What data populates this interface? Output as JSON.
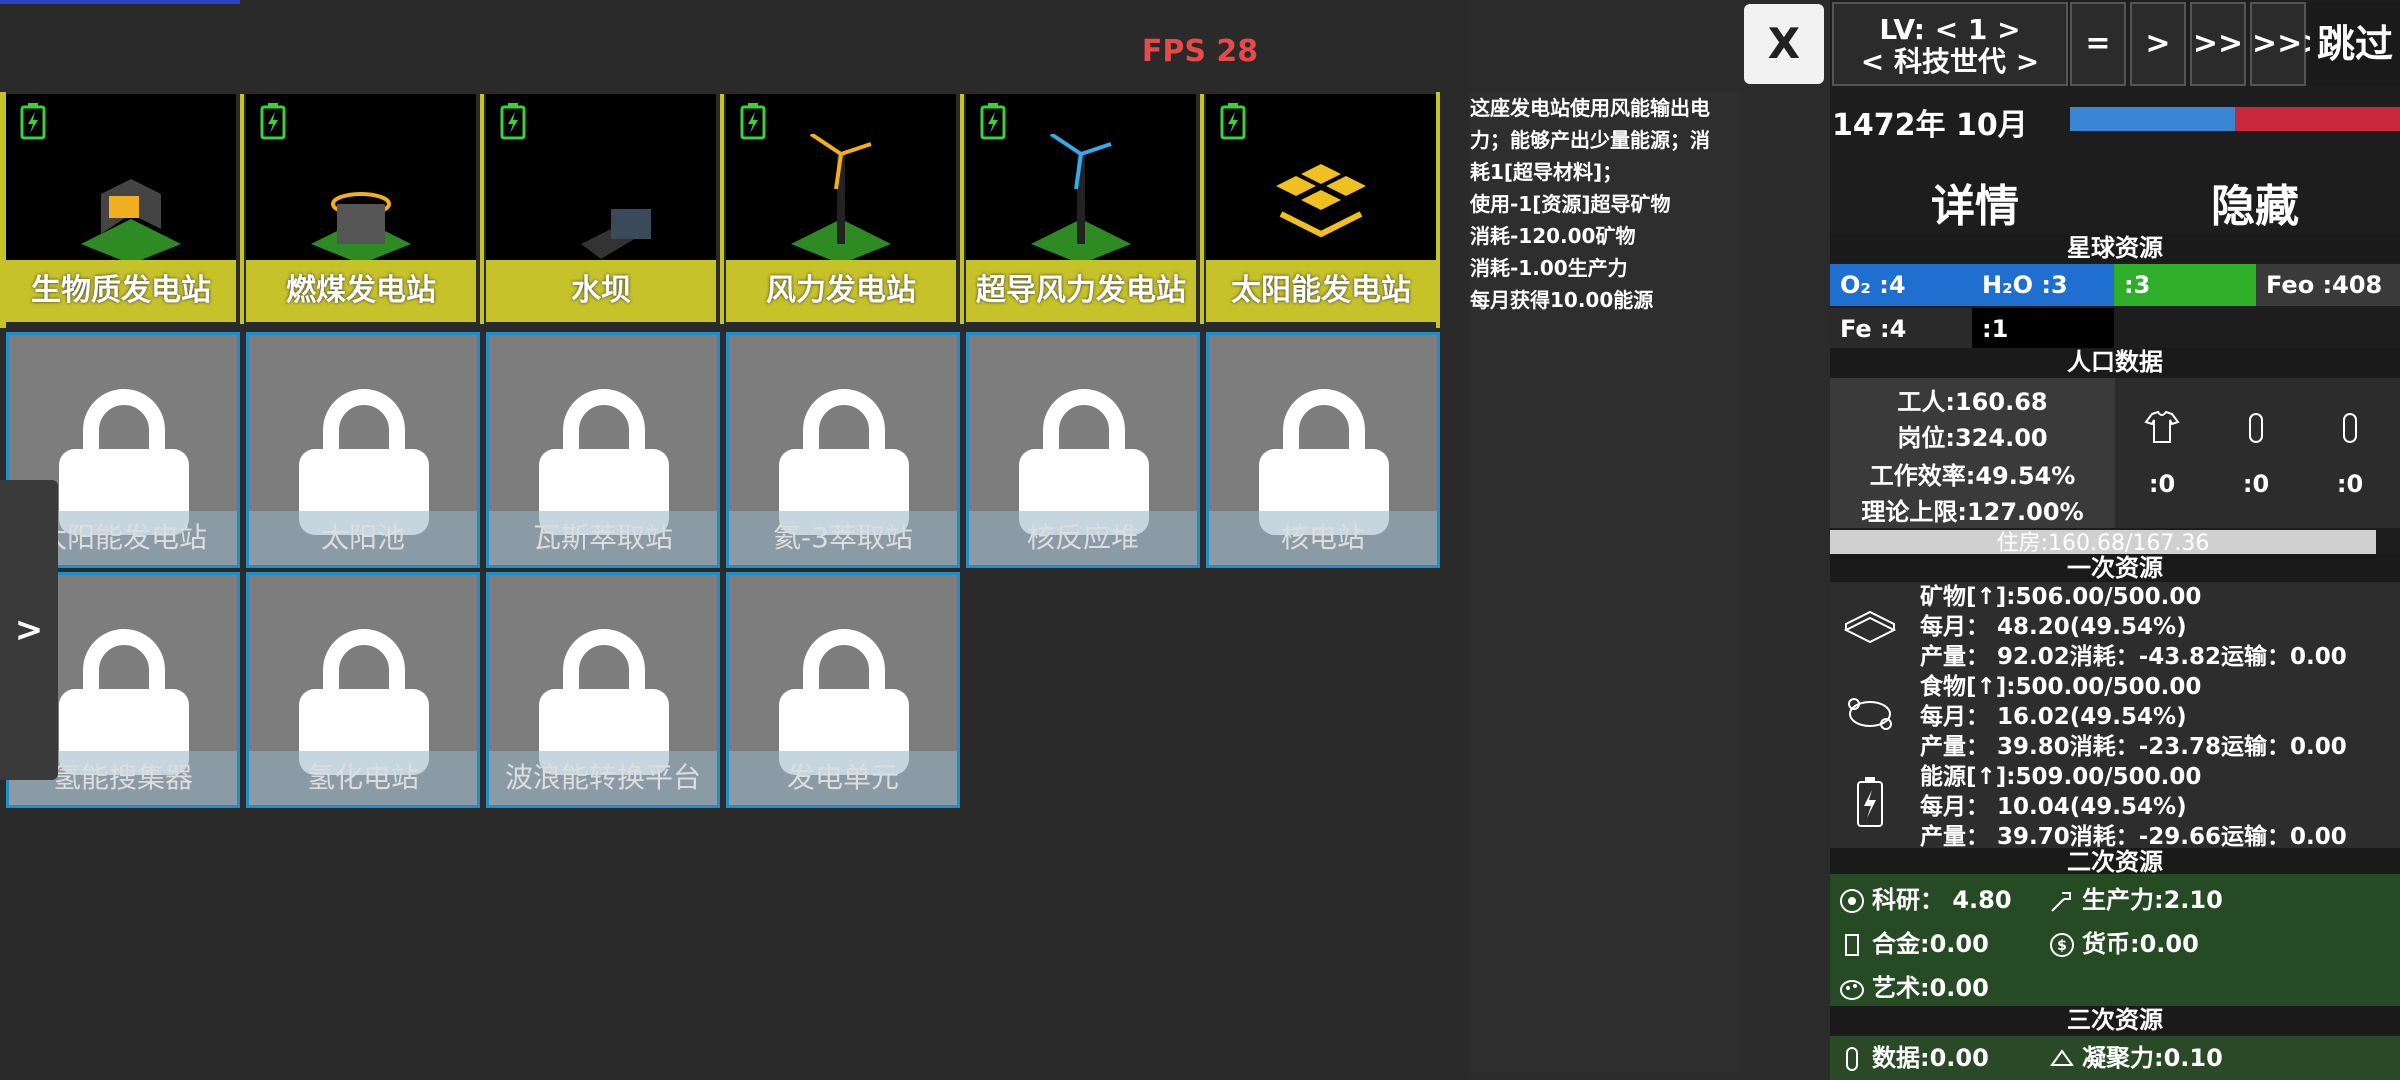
{
  "fps": "FPS 28",
  "close_label": "X",
  "side_tab_label": ">",
  "unlocked_buildings": [
    {
      "label": "生物质发电站"
    },
    {
      "label": "燃煤发电站"
    },
    {
      "label": "水坝"
    },
    {
      "label": "风力发电站"
    },
    {
      "label": "超导风力发电站"
    },
    {
      "label": "太阳能发电站"
    }
  ],
  "locked_buildings": [
    {
      "label": "太阳能发电站"
    },
    {
      "label": "太阳池"
    },
    {
      "label": "瓦斯萃取站"
    },
    {
      "label": "氦-3萃取站"
    },
    {
      "label": "核反应堆"
    },
    {
      "label": "核电站"
    },
    {
      "label": "氢能搜集器"
    },
    {
      "label": "氢化电站"
    },
    {
      "label": "波浪能转换平台"
    },
    {
      "label": "发电单元"
    }
  ],
  "description": {
    "lines": [
      "这座发电站使用风能输出电",
      "力；能够产出少量能源；消",
      "耗1[超导材料]；",
      "使用-1[资源]超导矿物",
      "消耗-120.00矿物",
      "消耗-1.00生产力",
      "每月获得10.00能源"
    ]
  },
  "header": {
    "level_line1": "LV: < 1 >",
    "level_line2": "< 科技世代 >",
    "speeds": [
      "=",
      ">",
      ">>",
      ">>>"
    ],
    "skip": "跳过",
    "date": "1472年 10月"
  },
  "panel_buttons": {
    "details": "详情",
    "hide": "隐藏"
  },
  "sections": {
    "planet": "星球资源",
    "population": "人口数据",
    "primary": "一次资源",
    "secondary": "二次资源",
    "tertiary": "三次资源"
  },
  "planet_resources": [
    {
      "label": "O₂ :4",
      "color": "#1f6fd0"
    },
    {
      "label": "H₂O :3",
      "color": "#1f6fd0"
    },
    {
      "label": ":3",
      "color": "#2fae2a"
    },
    {
      "label": "Feo :408",
      "color": "#3a3a3a"
    },
    {
      "label": "Fe :4",
      "color": "#2a2a2a"
    },
    {
      "label": ":1",
      "color": "#000000"
    }
  ],
  "population": {
    "workers": "工人:160.68",
    "jobs": "岗位:324.00",
    "efficiency": "工作效率:49.54%",
    "limit": "理论上限:127.00%",
    "job_counts": [
      ":0",
      ":0",
      ":0"
    ],
    "housing": "住房:160.68/167.36"
  },
  "primary_resources": [
    {
      "line1": "矿物[↑]:506.00/500.00",
      "line2": "每月： 48.20(49.54%)",
      "line3": "产量： 92.02消耗：-43.82运输：0.00"
    },
    {
      "line1": "食物[↑]:500.00/500.00",
      "line2": "每月： 16.02(49.54%)",
      "line3": "产量： 39.80消耗：-23.78运输：0.00"
    },
    {
      "line1": "能源[↑]:509.00/500.00",
      "line2": "每月： 10.04(49.54%)",
      "line3": "产量： 39.70消耗：-29.66运输：0.00"
    }
  ],
  "secondary_resources": {
    "research": "科研： 4.80",
    "productivity": "生产力:2.10",
    "alloy": "合金:0.00",
    "currency": "货币:0.00",
    "art": "艺术:0.00"
  },
  "tertiary_resources": {
    "data": "数据:0.00",
    "cohesion": "凝聚力:0.10"
  }
}
